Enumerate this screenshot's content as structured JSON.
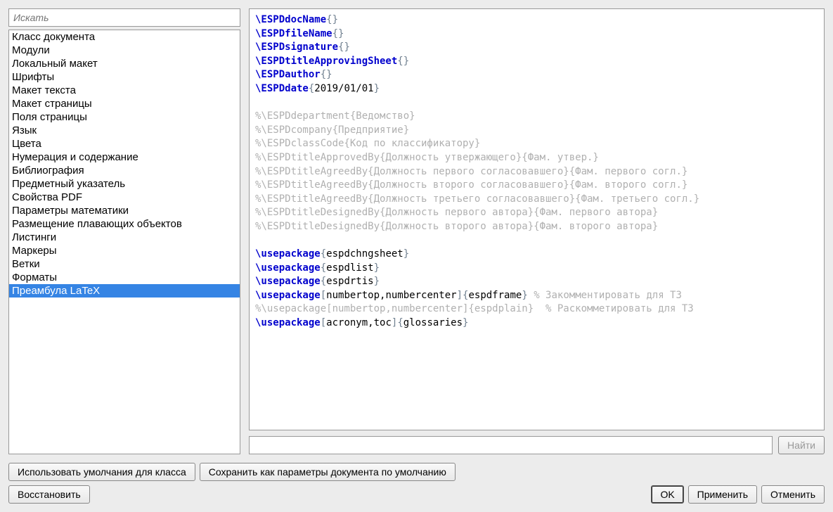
{
  "search": {
    "placeholder": "Искать"
  },
  "categories": [
    "Класс документа",
    "Модули",
    "Локальный макет",
    "Шрифты",
    "Макет текста",
    "Макет страницы",
    "Поля страницы",
    "Язык",
    "Цвета",
    "Нумерация и содержание",
    "Библиография",
    "Предметный указатель",
    "Свойства PDF",
    "Параметры математики",
    "Размещение плавающих объектов",
    "Листинги",
    "Маркеры",
    "Ветки",
    "Форматы",
    "Преамбула LaTeX"
  ],
  "selected_index": 19,
  "code": [
    {
      "t": "cmd",
      "p": [
        "\\",
        "ESPDdocName",
        "{}"
      ]
    },
    {
      "t": "cmd",
      "p": [
        "\\",
        "ESPDfileName",
        "{}"
      ]
    },
    {
      "t": "cmd",
      "p": [
        "\\",
        "ESPDsignature",
        "{}"
      ]
    },
    {
      "t": "cmd",
      "p": [
        "\\",
        "ESPDtitleApprovingSheet",
        "{}"
      ]
    },
    {
      "t": "cmd",
      "p": [
        "\\",
        "ESPDauthor",
        "{}"
      ]
    },
    {
      "t": "cmdarg",
      "p": [
        "\\",
        "ESPDdate",
        "{",
        "2019/01/01",
        "}"
      ]
    },
    {
      "t": "blank"
    },
    {
      "t": "comment",
      "text": "%\\ESPDdepartment{Ведомство}"
    },
    {
      "t": "comment",
      "text": "%\\ESPDcompany{Предприятие}"
    },
    {
      "t": "comment",
      "text": "%\\ESPDclassCode{Код по классификатору}"
    },
    {
      "t": "comment",
      "text": "%\\ESPDtitleApprovedBy{Должность утвержающего}{Фам. утвер.}"
    },
    {
      "t": "comment",
      "text": "%\\ESPDtitleAgreedBy{Должность первого согласовавшего}{Фам. первого согл.}"
    },
    {
      "t": "comment",
      "text": "%\\ESPDtitleAgreedBy{Должность второго согласовавшего}{Фам. второго согл.}"
    },
    {
      "t": "comment",
      "text": "%\\ESPDtitleAgreedBy{Должность третьего согласовавшего}{Фам. третьего согл.}"
    },
    {
      "t": "comment",
      "text": "%\\ESPDtitleDesignedBy{Должность первого автора}{Фам. первого автора}"
    },
    {
      "t": "comment",
      "text": "%\\ESPDtitleDesignedBy{Должность второго автора}{Фам. второго автора}"
    },
    {
      "t": "blank"
    },
    {
      "t": "cmdarg",
      "p": [
        "\\",
        "usepackage",
        "{",
        "espdchngsheet",
        "}"
      ]
    },
    {
      "t": "cmdarg",
      "p": [
        "\\",
        "usepackage",
        "{",
        "espdlist",
        "}"
      ]
    },
    {
      "t": "cmdarg",
      "p": [
        "\\",
        "usepackage",
        "{",
        "espdrtis",
        "}"
      ]
    },
    {
      "t": "cmdopt",
      "p": [
        "\\",
        "usepackage",
        "[",
        "numbertop,numbercenter",
        "]",
        "{",
        "espdframe",
        "}"
      ],
      "trail": " % Закомментировать для ТЗ"
    },
    {
      "t": "comment",
      "text": "%\\usepackage[numbertop,numbercenter]{espdplain}  % Раскомметировать для ТЗ"
    },
    {
      "t": "cmdopt",
      "p": [
        "\\",
        "usepackage",
        "[",
        "acronym,toc",
        "]",
        "{",
        "glossaries",
        "}"
      ]
    }
  ],
  "find": {
    "button": "Найти",
    "value": ""
  },
  "buttons": {
    "use_defaults": "Использовать умолчания для класса",
    "save_defaults": "Сохранить как параметры документа по умолчанию",
    "restore": "Восстановить",
    "ok": "OK",
    "apply": "Применить",
    "cancel": "Отменить"
  }
}
